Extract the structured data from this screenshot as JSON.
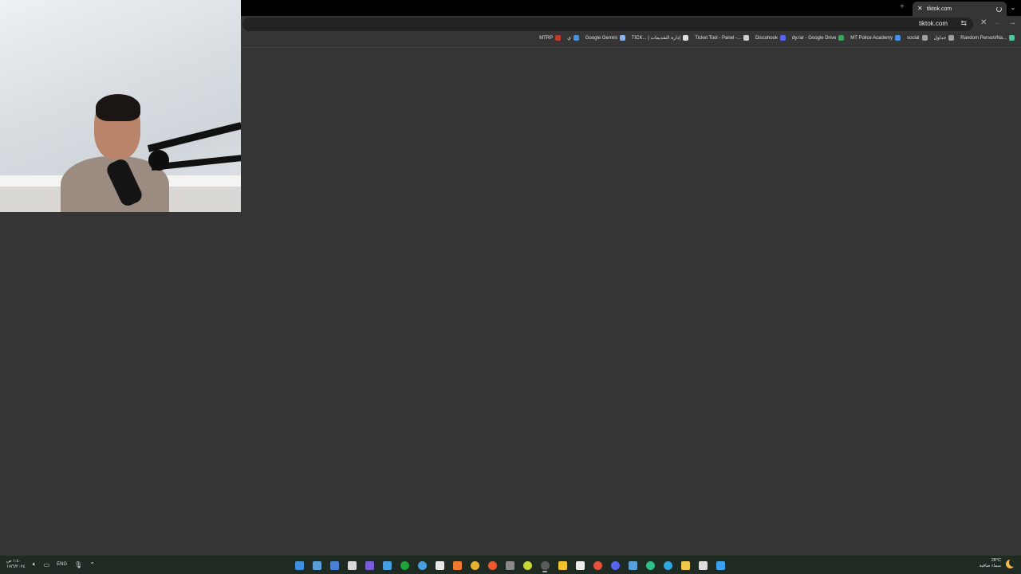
{
  "browser": {
    "tab": {
      "title": "tiktok.com",
      "close_glyph": "✕"
    },
    "new_tab_glyph": "+",
    "tab_menu_glyph": "⌄",
    "omnibox": {
      "url": "tiktok.com",
      "tune_icon": "tune-icon"
    },
    "toolbar": {
      "close_glyph": "✕",
      "back_glyph": "←",
      "forward_glyph": "→"
    },
    "bookmarks": [
      {
        "label": "Random Person/Na...",
        "color": "#4fc3a1"
      },
      {
        "label": "جداول",
        "color": "#9e9e9e"
      },
      {
        "label": "social",
        "color": "#9e9e9e"
      },
      {
        "label": "MT Police Academy",
        "color": "#4a90e2"
      },
      {
        "label": "dy.rar - Google Drive",
        "color": "#34a853"
      },
      {
        "label": "Discohook",
        "color": "#5865f2"
      },
      {
        "label": "Ticket Tool - Panel -...",
        "color": "#cfcfcf"
      },
      {
        "label": "TICK... | إدارة التقديمات",
        "color": "#e0e0e0"
      },
      {
        "label": "Google Gemini",
        "color": "#8ab4f8"
      },
      {
        "label": "ي",
        "color": "#4a90e2"
      },
      {
        "label": "MTRP",
        "color": "#c0392b"
      }
    ]
  },
  "taskbar": {
    "clock": {
      "time": "١:٤٠ ص",
      "date": "١٧/٦/٢٠٢٤"
    },
    "language": "ENG",
    "weather": {
      "temp": "28°C",
      "desc": "سماء صافية"
    },
    "apps": [
      {
        "name": "snipping-tool-icon",
        "color": "#3a8fe0"
      },
      {
        "name": "steam-icon",
        "color": "#5aa0d8"
      },
      {
        "name": "calculator-icon",
        "color": "#4a7fd6"
      },
      {
        "name": "unity-icon",
        "color": "#d9d9d9"
      },
      {
        "name": "visual-studio-icon",
        "color": "#7a5cd6"
      },
      {
        "name": "photos-icon",
        "color": "#46a0e0"
      },
      {
        "name": "xbox-icon",
        "color": "#1fa43a"
      },
      {
        "name": "settings-icon",
        "color": "#46a0e0"
      },
      {
        "name": "capcut-icon",
        "color": "#e8e8e8"
      },
      {
        "name": "xampp-icon",
        "color": "#f07a2e"
      },
      {
        "name": "chrome-icon",
        "color": "#e8b32a"
      },
      {
        "name": "brave-icon",
        "color": "#f05a2a"
      },
      {
        "name": "x-icon",
        "color": "#888888"
      },
      {
        "name": "tennis-ball-icon",
        "color": "#c6d932"
      },
      {
        "name": "obs-icon",
        "color": "#5b5b5b",
        "active": true
      },
      {
        "name": "feather-icon",
        "color": "#f2c12e"
      },
      {
        "name": "calendar-icon",
        "color": "#ececec"
      },
      {
        "name": "chrome-profile-icon",
        "color": "#e84f3d"
      },
      {
        "name": "discord-icon",
        "color": "#5865f2"
      },
      {
        "name": "steam-alt-icon",
        "color": "#5aa0d8"
      },
      {
        "name": "edge-icon",
        "color": "#2fbf8a"
      },
      {
        "name": "telegram-icon",
        "color": "#2ea6df"
      },
      {
        "name": "file-explorer-icon",
        "color": "#f2c94c"
      },
      {
        "name": "search-icon",
        "color": "#dddddd"
      },
      {
        "name": "start-icon",
        "color": "#3aa0f0"
      }
    ]
  }
}
